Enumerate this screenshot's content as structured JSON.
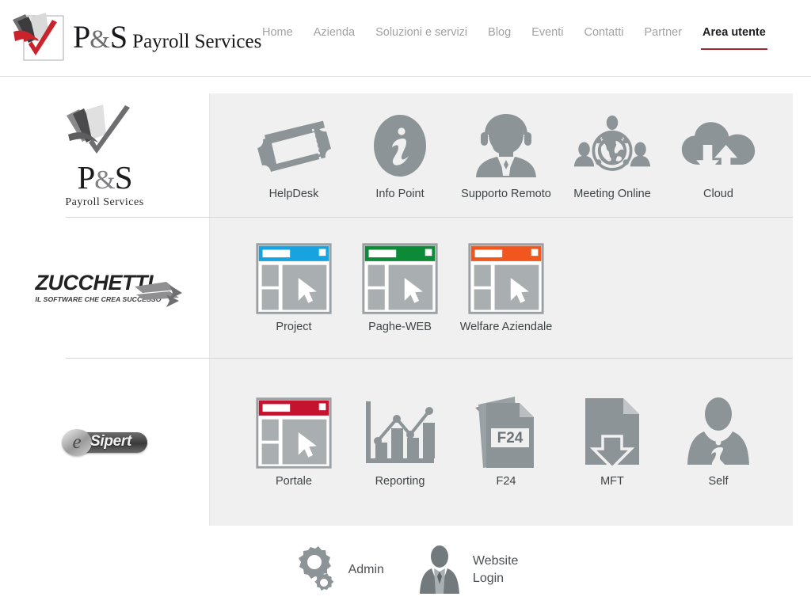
{
  "header": {
    "brand": {
      "ps": "P",
      "amp": "&",
      "s": "S",
      "subtitle": "Payroll Services",
      "logo_icon": "open-book-checkmark-logo"
    },
    "nav": [
      {
        "label": "Home",
        "active": false
      },
      {
        "label": "Azienda",
        "active": false
      },
      {
        "label": "Soluzioni e servizi",
        "active": false
      },
      {
        "label": "Blog",
        "active": false
      },
      {
        "label": "Eventi",
        "active": false
      },
      {
        "label": "Contatti",
        "active": false
      },
      {
        "label": "Partner",
        "active": false
      },
      {
        "label": "Area utente",
        "active": true
      }
    ]
  },
  "colors": {
    "accent_red": "#9d2b2b",
    "panel_bg": "#f0f0f0",
    "icon_gray": "#8d9497",
    "label_text": "#3f4447",
    "nav_inactive": "#a2a2a4",
    "project_blue": "#16a3e0",
    "paghe_green": "#0c8a37",
    "welfare_orange": "#f0561d",
    "portale_red": "#c4122f"
  },
  "sections": [
    {
      "id": "ps-services",
      "logo": {
        "type": "ps-logo",
        "ps": "P",
        "amp": "&",
        "s": "S",
        "subtitle": "Payroll Services"
      },
      "items": [
        {
          "label": "HelpDesk",
          "icon": "ticket-icon"
        },
        {
          "label": "Info Point",
          "icon": "info-circle-icon"
        },
        {
          "label": "Supporto Remoto",
          "icon": "headset-person-icon"
        },
        {
          "label": "Meeting Online",
          "icon": "globe-people-icon"
        },
        {
          "label": "Cloud",
          "icon": "cloud-sync-icon"
        }
      ]
    },
    {
      "id": "zucchetti-services",
      "logo": {
        "type": "zucchetti-logo",
        "name": "ZUCCHETTI",
        "tagline": "IL SOFTWARE CHE CREA SUCCESSO"
      },
      "items": [
        {
          "label": "Project",
          "icon": "browser-window-icon",
          "bar_color": "#16a3e0"
        },
        {
          "label": "Paghe-WEB",
          "icon": "browser-window-icon",
          "bar_color": "#0c8a37"
        },
        {
          "label": "Welfare Aziendale",
          "icon": "browser-window-icon",
          "bar_color": "#f0561d"
        }
      ]
    },
    {
      "id": "esipert-services",
      "logo": {
        "type": "esipert-logo",
        "e": "e",
        "word": "Sipert"
      },
      "items": [
        {
          "label": "Portale",
          "icon": "browser-window-icon",
          "bar_color": "#c4122f"
        },
        {
          "label": "Reporting",
          "icon": "bar-chart-icon"
        },
        {
          "label": "F24",
          "icon": "documents-f24-icon",
          "doc_text": "F24"
        },
        {
          "label": "MFT",
          "icon": "document-download-icon"
        },
        {
          "label": "Self",
          "icon": "person-info-icon"
        }
      ]
    }
  ],
  "footer": {
    "items": [
      {
        "label": "Admin",
        "label2": "",
        "icon": "gears-icon"
      },
      {
        "label": "Website",
        "label2": "Login",
        "icon": "businessman-icon"
      }
    ]
  }
}
